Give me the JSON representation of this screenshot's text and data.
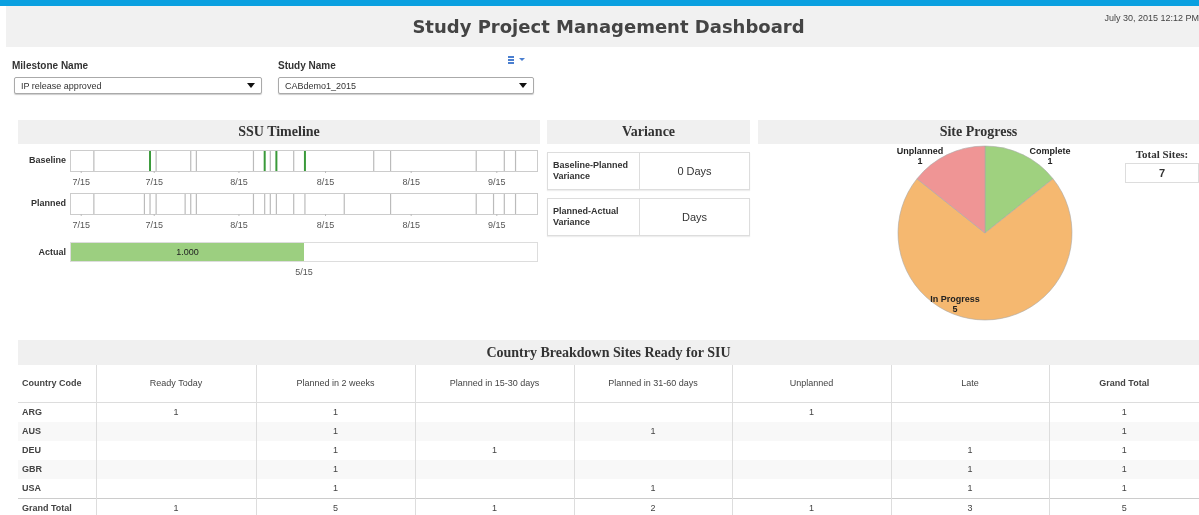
{
  "header": {
    "title": "Study Project Management Dashboard",
    "timestamp": "July 30, 2015 12:12 PM"
  },
  "filters": [
    {
      "label": "Milestone Name",
      "value": "IP release approved"
    },
    {
      "label": "Study Name",
      "value": "CABdemo1_2015"
    }
  ],
  "timeline": {
    "title": "SSU Timeline",
    "rows": [
      {
        "label": "Baseline",
        "ticks": [
          "7/15",
          "7/15",
          "8/15",
          "8/15",
          "8/15",
          "9/15"
        ]
      },
      {
        "label": "Planned",
        "ticks": [
          "7/15",
          "7/15",
          "8/15",
          "8/15",
          "8/15",
          "9/15"
        ]
      }
    ],
    "actual": {
      "label": "Actual",
      "level": 0.5,
      "value": "1.000",
      "tick": "5/15"
    }
  },
  "variance": {
    "title": "Variance",
    "rows": [
      {
        "label": "Baseline-Planned Variance",
        "value": "0 Days"
      },
      {
        "label": "Planned-Actual Variance",
        "value": "Days"
      }
    ]
  },
  "site_progress": {
    "title": "Site Progress",
    "total_label": "Total Sites:",
    "total": "7",
    "chart_data": {
      "type": "pie",
      "categories": [
        "Complete",
        "In Progress",
        "Unplanned"
      ],
      "values": [
        1,
        5,
        1
      ],
      "colors": [
        "#9fd17f",
        "#f5b870",
        "#ef9595"
      ],
      "data_labels": true
    }
  },
  "country_table": {
    "title": "Country Breakdown Sites Ready for SIU",
    "columns": [
      "Country Code",
      "Ready Today",
      "Planned in 2 weeks",
      "Planned in 15-30 days",
      "Planned in 31-60 days",
      "Unplanned",
      "Late",
      "Grand Total"
    ],
    "rows": [
      [
        "ARG",
        "1",
        "1",
        "",
        "",
        "1",
        "",
        "1"
      ],
      [
        "AUS",
        "",
        "1",
        "",
        "1",
        "",
        "",
        "1"
      ],
      [
        "DEU",
        "",
        "1",
        "1",
        "",
        "",
        "1",
        "1"
      ],
      [
        "GBR",
        "",
        "1",
        "",
        "",
        "",
        "1",
        "1"
      ],
      [
        "USA",
        "",
        "1",
        "",
        "1",
        "",
        "1",
        "1"
      ]
    ],
    "total_row": [
      "Grand Total",
      "1",
      "5",
      "1",
      "2",
      "1",
      "3",
      "5"
    ]
  }
}
